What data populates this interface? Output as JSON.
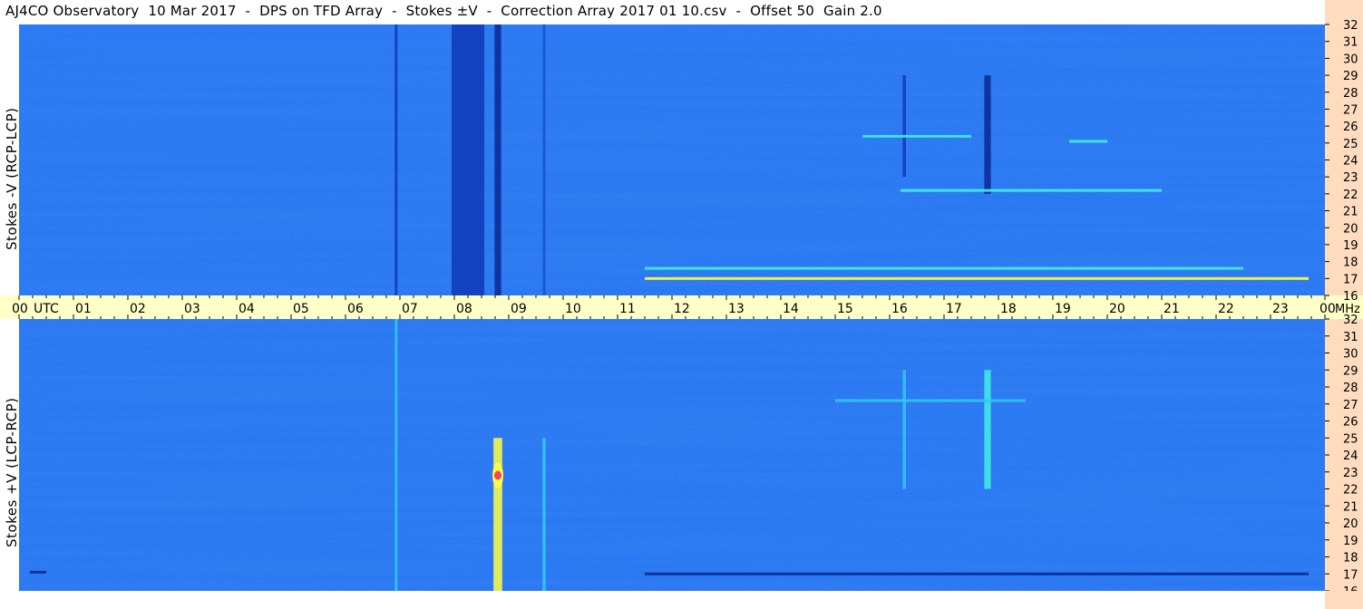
{
  "title": "AJ4CO Observatory  10 Mar 2017  -  DPS on TFD Array  -  Stokes ±V  -  Correction Array 2017 01 10.csv  -  Offset 50  Gain 2.0",
  "colors": {
    "background": "#1e6ef0",
    "time_axis_bg": "#ffffc8",
    "freq_axis_bg": "#ffdcc0",
    "bright_emission": "#ffff40",
    "peak_emission": "#ff4060"
  },
  "chart_data": [
    {
      "type": "heatmap",
      "panel": "top",
      "ylabel": "Stokes -V (RCP-LCP)",
      "y_ticks": [
        "16",
        "17",
        "18",
        "19",
        "20",
        "21",
        "22",
        "23",
        "24",
        "25",
        "26",
        "27",
        "28",
        "29",
        "30",
        "31",
        "32"
      ],
      "y_unit": "MHz",
      "ylim": [
        16,
        32
      ],
      "xlim": [
        0,
        24
      ],
      "features": [
        {
          "kind": "broadband_dark",
          "x": 6.93,
          "width": 0.05,
          "y": [
            16,
            32
          ],
          "level": -0.6
        },
        {
          "kind": "broadband_dark",
          "x": 8.25,
          "width": 0.6,
          "y": [
            16,
            32
          ],
          "level": -0.5
        },
        {
          "kind": "broadband_dark",
          "x": 8.8,
          "width": 0.12,
          "y": [
            16,
            32
          ],
          "level": -0.9
        },
        {
          "kind": "broadband_dark",
          "x": 9.65,
          "width": 0.05,
          "y": [
            16,
            32
          ],
          "level": -0.3
        },
        {
          "kind": "broadband_dark",
          "x": 16.27,
          "width": 0.06,
          "y": [
            23,
            29
          ],
          "level": -0.7
        },
        {
          "kind": "broadband_dark",
          "x": 17.8,
          "width": 0.12,
          "y": [
            22,
            29
          ],
          "level": -0.8
        },
        {
          "kind": "narrowband_bright",
          "x": [
            11.5,
            23.7
          ],
          "y": 17.0,
          "level": 0.9
        },
        {
          "kind": "narrowband_bright",
          "x": [
            11.5,
            22.5
          ],
          "y": 17.6,
          "level": 0.7
        },
        {
          "kind": "narrowband_bright",
          "x": [
            16.2,
            21.0
          ],
          "y": 22.2,
          "level": 0.6
        },
        {
          "kind": "narrowband_bright",
          "x": [
            15.5,
            17.5
          ],
          "y": 25.4,
          "level": 0.6
        },
        {
          "kind": "narrowband_bright",
          "x": [
            19.3,
            20.0
          ],
          "y": 25.1,
          "level": 0.6
        }
      ]
    },
    {
      "type": "heatmap",
      "panel": "bottom",
      "ylabel": "Stokes +V (LCP-RCP)",
      "y_ticks": [
        "16",
        "17",
        "18",
        "19",
        "20",
        "21",
        "22",
        "23",
        "24",
        "25",
        "26",
        "27",
        "28",
        "29",
        "30",
        "31",
        "32"
      ],
      "y_unit": "MHz",
      "ylim": [
        16,
        32
      ],
      "xlim": [
        0,
        24
      ],
      "features": [
        {
          "kind": "broadband_bright",
          "x": 6.93,
          "width": 0.05,
          "y": [
            16,
            32
          ],
          "level": 0.5
        },
        {
          "kind": "broadband_bright",
          "x": 8.8,
          "width": 0.16,
          "y": [
            16,
            25
          ],
          "level": 0.8
        },
        {
          "kind": "peak",
          "x": 8.8,
          "y": 22.8,
          "level": 1.0
        },
        {
          "kind": "broadband_bright",
          "x": 9.65,
          "width": 0.06,
          "y": [
            16,
            25
          ],
          "level": 0.5
        },
        {
          "kind": "broadband_bright",
          "x": 16.27,
          "width": 0.06,
          "y": [
            22,
            29
          ],
          "level": 0.5
        },
        {
          "kind": "broadband_bright",
          "x": 17.8,
          "width": 0.12,
          "y": [
            22,
            29
          ],
          "level": 0.6
        },
        {
          "kind": "narrowband_dark",
          "x": [
            11.5,
            23.7
          ],
          "y": 17.0,
          "level": -0.9
        },
        {
          "kind": "narrowband_dark",
          "x": [
            0.2,
            0.5
          ],
          "y": 17.1,
          "level": -0.9
        },
        {
          "kind": "narrowband_bright",
          "x": [
            15.0,
            18.5
          ],
          "y": 27.2,
          "level": 0.5
        }
      ]
    }
  ],
  "time_axis": {
    "labels": [
      "00",
      "01",
      "02",
      "03",
      "04",
      "05",
      "06",
      "07",
      "08",
      "09",
      "10",
      "11",
      "12",
      "13",
      "14",
      "15",
      "16",
      "17",
      "18",
      "19",
      "20",
      "21",
      "22",
      "23",
      "00"
    ],
    "unit_utc": "UTC",
    "unit_mhz": "MHz"
  }
}
